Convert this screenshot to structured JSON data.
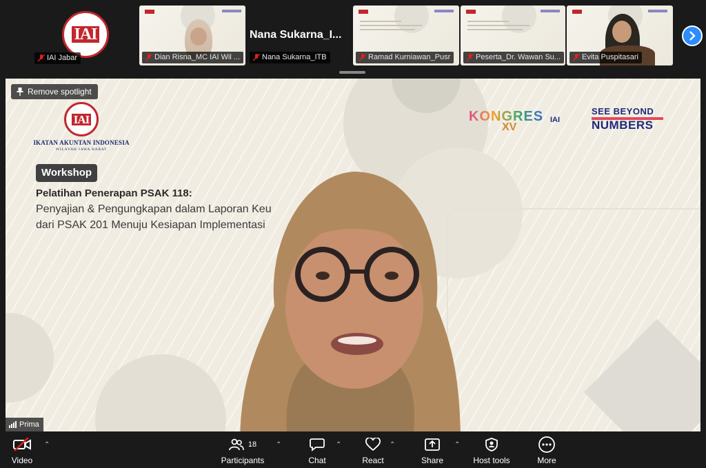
{
  "participants_strip": [
    {
      "name": "IAI Jabar",
      "kind": "logo"
    },
    {
      "name": "Dian Risna_MC IAI Wil ...",
      "kind": "video"
    },
    {
      "name": "Nana Sukarna_ITB",
      "kind": "name-only",
      "display_name": "Nana  Sukarna_I..."
    },
    {
      "name": "Ramad Kurniawan_Pusr",
      "kind": "slide"
    },
    {
      "name": "Peserta_Dr. Wawan Su...",
      "kind": "slide"
    },
    {
      "name": "Evita Puspitasari",
      "kind": "video"
    }
  ],
  "spotlight": {
    "label": "Remove spotlight"
  },
  "slide": {
    "org_logo_text": "IAI",
    "org_name": "IKATAN AKUNTAN INDONESIA",
    "org_region": "WILAYAH JAWA BARAT",
    "badge": "Workshop",
    "title": "Pelatihan Penerapan PSAK 118:",
    "line2": "Penyajian & Pengungkapan dalam Laporan Keu",
    "line3": "dari PSAK 201 Menuju Kesiapan Implementasi",
    "kongres": "KONGRES",
    "kongres_num": "XV",
    "see_beyond_1": "SEE BEYOND",
    "see_beyond_2": "NUMBERS"
  },
  "speaker": {
    "name": "Prima"
  },
  "toolbar": {
    "video": "Video",
    "participants": "Participants",
    "participants_count": "18",
    "chat": "Chat",
    "react": "React",
    "share": "Share",
    "host_tools": "Host tools",
    "more": "More"
  },
  "colors": {
    "accent": "#2d8cff",
    "brand_red": "#c1272d",
    "navy": "#1e2a7a",
    "muted_red": "#e02020"
  }
}
